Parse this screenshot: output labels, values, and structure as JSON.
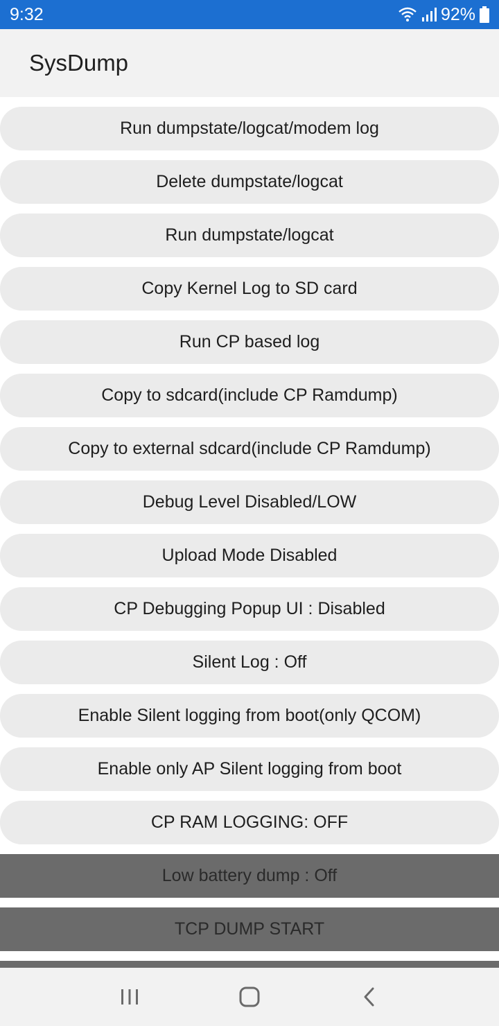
{
  "status_bar": {
    "time": "9:32",
    "battery": "92%",
    "icons": [
      "wifi-icon",
      "signal-icon",
      "battery-icon"
    ]
  },
  "app_bar": {
    "title": "SysDump"
  },
  "buttons": [
    "Run dumpstate/logcat/modem log",
    "Delete dumpstate/logcat",
    "Run dumpstate/logcat",
    "Copy Kernel Log to SD card",
    "Run CP based log",
    "Copy to sdcard(include CP Ramdump)",
    "Copy to external sdcard(include CP Ramdump)",
    "Debug Level Disabled/LOW",
    "Upload Mode Disabled",
    "CP Debugging Popup UI : Disabled",
    "Silent Log : Off",
    "Enable Silent logging from boot(only QCOM)",
    "Enable only AP Silent logging from boot",
    "CP RAM LOGGING: OFF",
    "Low battery dump : Off",
    "TCP DUMP START"
  ],
  "nav_bar": {
    "icons": [
      "recent-apps-icon",
      "home-icon",
      "back-icon"
    ]
  },
  "colors": {
    "status_bar": "#1c6fd1",
    "app_bar": "#f2f2f2",
    "button_rounded": "#ebebeb",
    "button_flat": "#6b6b6b"
  }
}
